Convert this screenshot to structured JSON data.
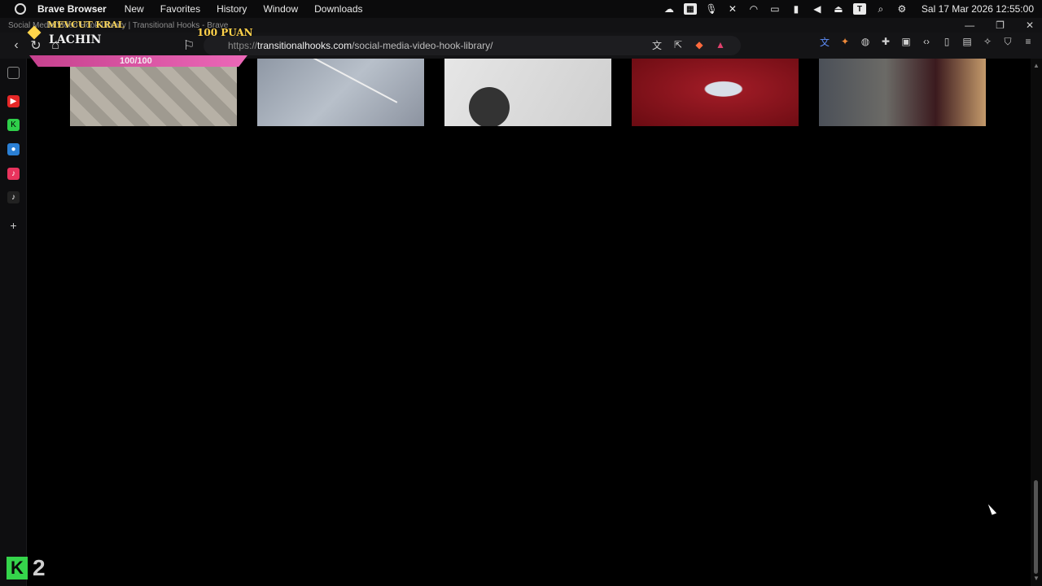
{
  "menubar": {
    "app_name": "Brave Browser",
    "items": [
      "New",
      "Favorites",
      "History",
      "Window",
      "Downloads"
    ],
    "datetime": "Sal 17 Mar 2026 12:55:00",
    "status_box_letter": "T"
  },
  "window": {
    "title": "Social Media Video Hook Library | Transitional Hooks - Brave"
  },
  "toolbar": {
    "url_proto": "https://",
    "url_host": "transitionalhooks.com",
    "url_path": "/social-media-video-hook-library/"
  },
  "overlay": {
    "label_top": "MEVCUT KRAL",
    "label_name": "LACHIN",
    "points": "100 PUAN",
    "score": "100/100"
  },
  "badge": {
    "k_letter": "K",
    "count": "2"
  }
}
